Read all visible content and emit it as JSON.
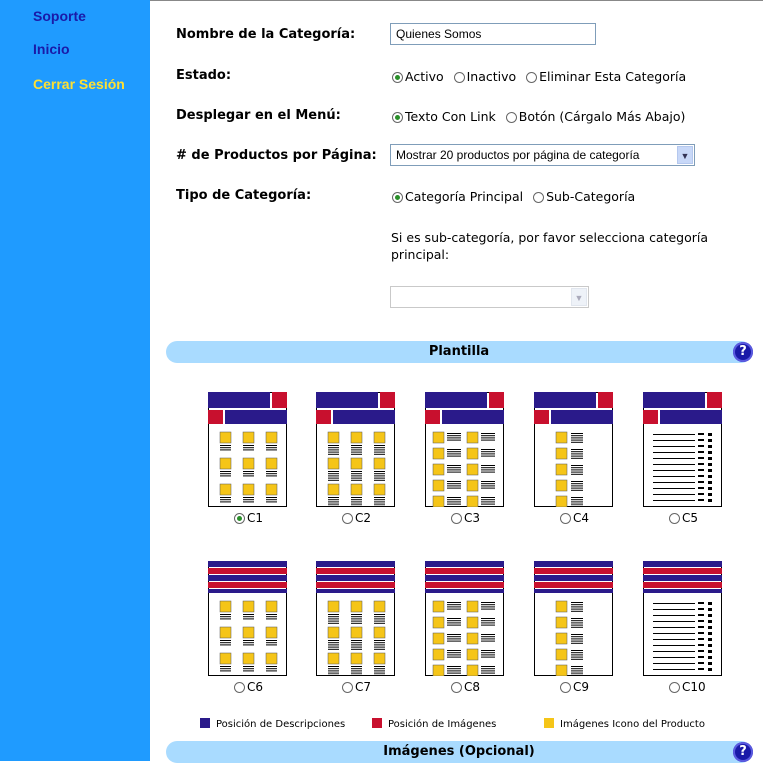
{
  "sidebar": {
    "items": [
      {
        "label": "Soporte",
        "color": "#1a1aa8"
      },
      {
        "label": "Inicio",
        "color": "#1a1aa8"
      },
      {
        "label": "Cerrar Sesión",
        "color": "#ffe033"
      }
    ]
  },
  "form": {
    "name_label": "Nombre de la Categoría:",
    "name_value": "Quienes Somos",
    "estado_label": "Estado:",
    "estado_options": [
      "Activo",
      "Inactivo",
      "Eliminar Esta Categoría"
    ],
    "estado_selected": "Activo",
    "menu_label": "Desplegar en el Menú:",
    "menu_options": [
      "Texto Con Link",
      "Botón (Cárgalo Más Abajo)"
    ],
    "menu_selected": "Texto Con Link",
    "products_label": "# de Productos por Página:",
    "products_value": "Mostrar 20 productos por página de categoría",
    "tipo_label": "Tipo de Categoría:",
    "tipo_options": [
      "Categoría Principal",
      "Sub-Categoría"
    ],
    "tipo_selected": "Categoría Principal",
    "sub_help": "Si es sub-categoría, por favor selecciona categoría principal:",
    "sub_select_value": ""
  },
  "plantilla": {
    "title": "Plantilla",
    "help_icon": "?",
    "templates": [
      {
        "label": "C1",
        "selected": true
      },
      {
        "label": "C2",
        "selected": false
      },
      {
        "label": "C3",
        "selected": false
      },
      {
        "label": "C4",
        "selected": false
      },
      {
        "label": "C5",
        "selected": false
      },
      {
        "label": "C6",
        "selected": false
      },
      {
        "label": "C7",
        "selected": false
      },
      {
        "label": "C8",
        "selected": false
      },
      {
        "label": "C9",
        "selected": false
      },
      {
        "label": "C10",
        "selected": false
      }
    ],
    "legend": [
      {
        "label": "Posición de Descripciones",
        "color": "#2a1a8a"
      },
      {
        "label": "Posición de Imágenes",
        "color": "#c8102e"
      },
      {
        "label": "Imágenes Icono del Producto",
        "color": "#f5c518"
      }
    ]
  },
  "imagenes": {
    "title": "Imágenes (Opcional)",
    "help_icon": "?"
  },
  "colors": {
    "sidebar_bg": "#1f9bff",
    "section_bar": "#a9dbff",
    "description_block": "#2a1a8a",
    "image_block": "#c8102e",
    "product_icon": "#f5c518"
  }
}
